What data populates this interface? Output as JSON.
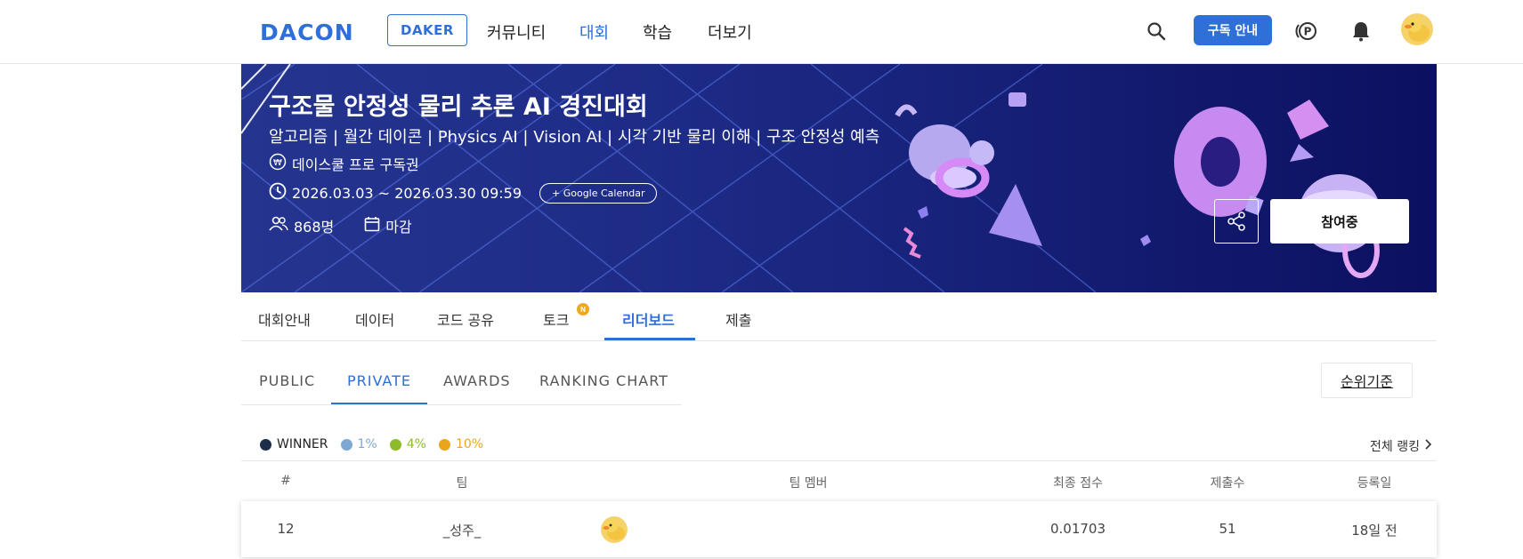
{
  "header": {
    "logo": "DACON",
    "daker": "DAKER",
    "nav": [
      "커뮤니티",
      "대회",
      "학습",
      "더보기"
    ],
    "subscribe_label": "구독 안내",
    "icons": [
      "search-icon",
      "point-icon",
      "bell-icon",
      "avatar"
    ]
  },
  "banner": {
    "title": "구조물 안정성 물리 추론 AI 경진대회",
    "subtitle": "알고리즘 | 월간 데이콘 | Physics AI | Vision AI | 시각 기반 물리 이해 | 구조 안정성 예측",
    "prize": "데이스쿨 프로 구독권",
    "period": "2026.03.03 ~ 2026.03.30 09:59",
    "calendar_button": "+ Google Calendar",
    "participants": "868명",
    "status": "마감",
    "join_label": "참여중"
  },
  "tabs": {
    "items": [
      "대회안내",
      "데이터",
      "코드 공유",
      "토크",
      "리더보드",
      "제출"
    ],
    "active": "리더보드",
    "new_badge": "N"
  },
  "leaderboard": {
    "tabs": [
      "PUBLIC",
      "PRIVATE",
      "AWARDS",
      "RANKING CHART"
    ],
    "active": "PRIVATE",
    "criteria_label": "순위기준",
    "all_ranking": "전체 랭킹",
    "legend": [
      {
        "label": "WINNER",
        "color": "#1e2d4a"
      },
      {
        "label": "1%",
        "color": "#7ea8d2"
      },
      {
        "label": "4%",
        "color": "#8dbb2c"
      },
      {
        "label": "10%",
        "color": "#eba51c"
      }
    ],
    "columns": [
      "#",
      "팀",
      "팀 멤버",
      "최종 점수",
      "제출수",
      "등록일"
    ],
    "rows": [
      {
        "rank": "12",
        "team": "_성주_",
        "score": "0.01703",
        "submissions": "51",
        "registered": "18일 전"
      }
    ]
  },
  "colors": {
    "accent": "#2f6fd8",
    "banner_dark": "#0c1060"
  }
}
